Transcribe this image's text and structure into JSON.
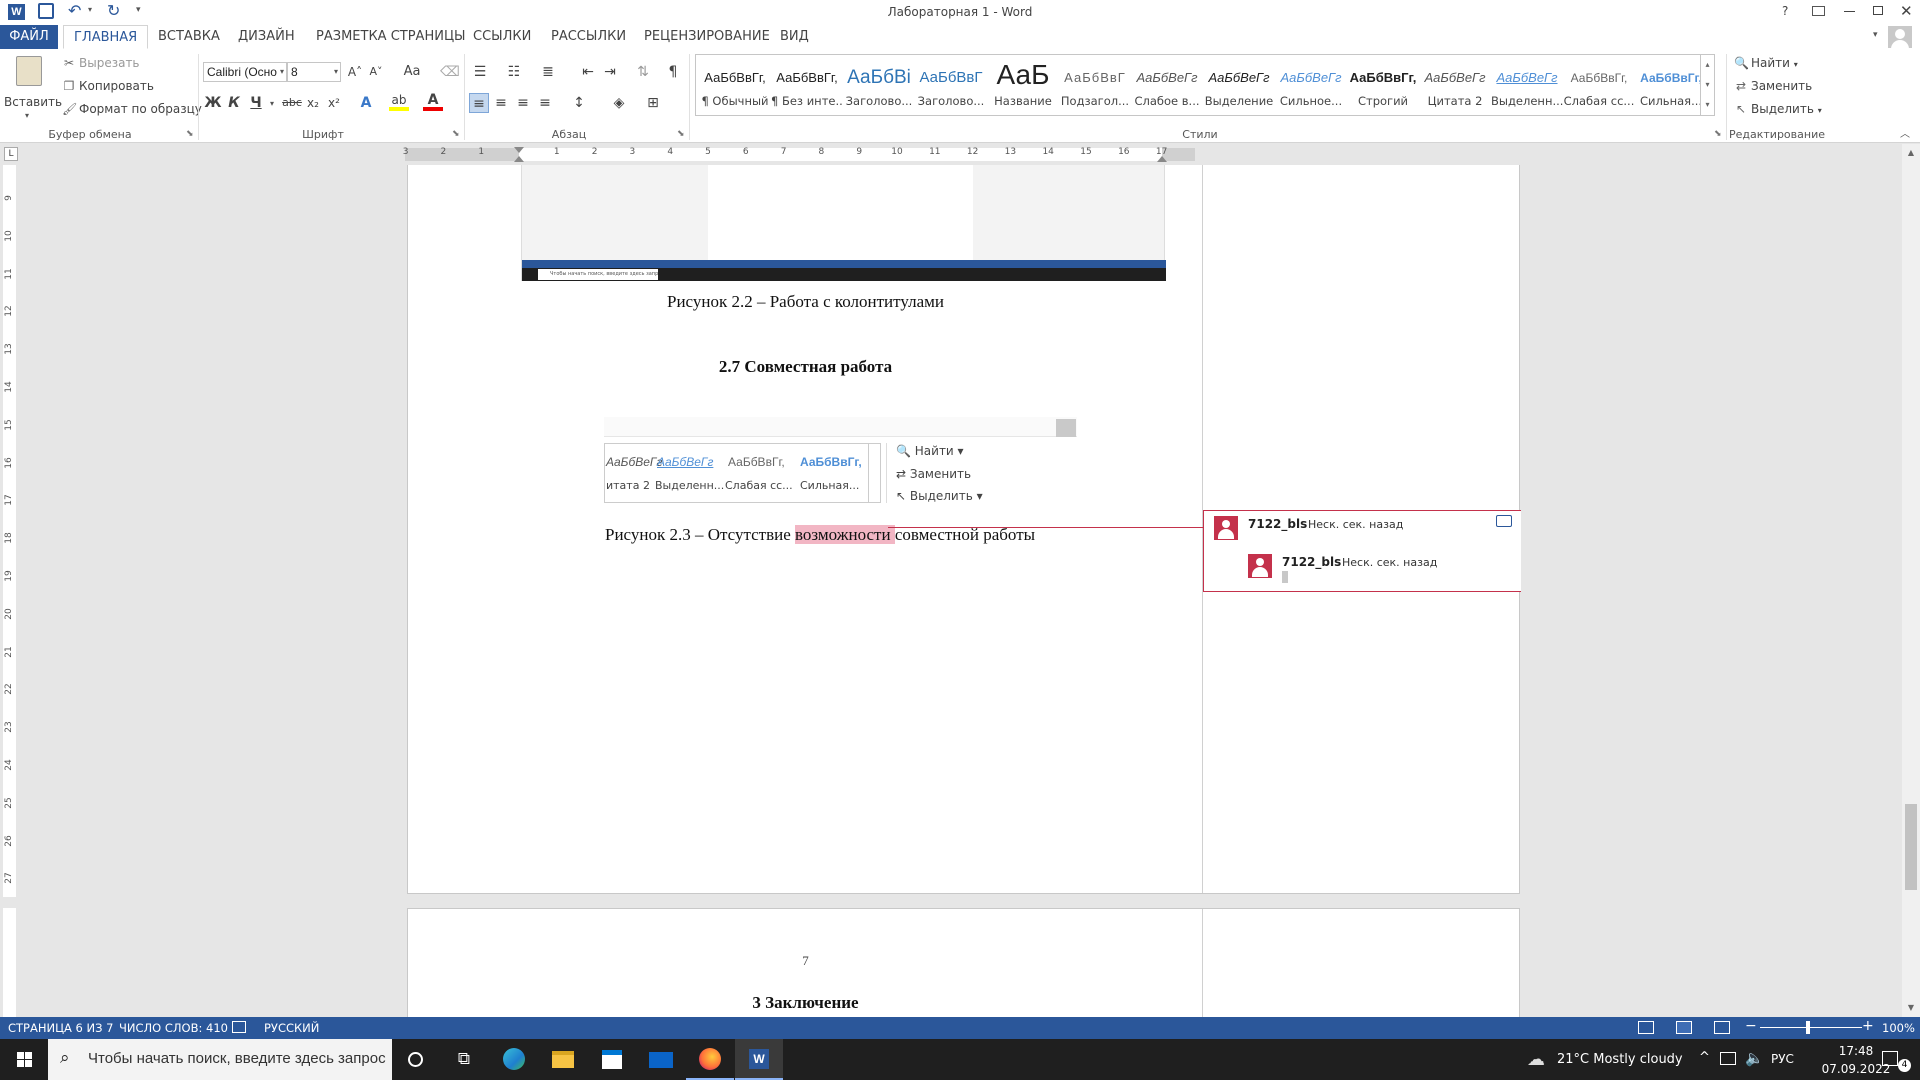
{
  "window": {
    "title": "Лабораторная 1 - Word",
    "controls": [
      "?",
      "⧉",
      "—",
      "❐",
      "✕"
    ]
  },
  "tabs": [
    {
      "label": "ФАЙЛ"
    },
    {
      "label": "ГЛАВНАЯ"
    },
    {
      "label": "ВСТАВКА"
    },
    {
      "label": "ДИЗАЙН"
    },
    {
      "label": "РАЗМЕТКА СТРАНИЦЫ"
    },
    {
      "label": "ССЫЛКИ"
    },
    {
      "label": "РАССЫЛКИ"
    },
    {
      "label": "РЕЦЕНЗИРОВАНИЕ"
    },
    {
      "label": "ВИД"
    }
  ],
  "clipboard": {
    "paste": "Вставить",
    "cut": "Вырезать",
    "copy": "Копировать",
    "format_painter": "Формат по образцу",
    "group": "Буфер обмена"
  },
  "font": {
    "name": "Calibri (Осно",
    "size": "8",
    "group": "Шрифт",
    "bold": "Ж",
    "italic": "К",
    "underline": "Ч",
    "strike": "abc",
    "sub": "x₂",
    "sup": "x²",
    "grow": "A˄",
    "shrink": "A˅",
    "case": "Aa"
  },
  "paragraph": {
    "group": "Абзац"
  },
  "styles": {
    "group": "Стили",
    "items": [
      {
        "sample": "АаБбВвГг,",
        "name": "¶ Обычный"
      },
      {
        "sample": "АаБбВвГг,",
        "name": "¶ Без инте..."
      },
      {
        "sample": "АаБбВі",
        "name": "Заголово..."
      },
      {
        "sample": "АаБбВвГ",
        "name": "Заголово..."
      },
      {
        "sample": "АаБ",
        "name": "Название"
      },
      {
        "sample": "АаБбВвГ",
        "name": "Подзагол..."
      },
      {
        "sample": "АаБбВеГг",
        "name": "Слабое в..."
      },
      {
        "sample": "АаБбВеГг",
        "name": "Выделение"
      },
      {
        "sample": "АаБбВеГг",
        "name": "Сильное..."
      },
      {
        "sample": "АаБбВвГг,",
        "name": "Строгий"
      },
      {
        "sample": "АаБбВеГг",
        "name": "Цитата 2"
      },
      {
        "sample": "АаБбВеГг",
        "name": "Выделенн..."
      },
      {
        "sample": "АаБбВвГг,",
        "name": "Слабая сс..."
      },
      {
        "sample": "АаБбВвГг,",
        "name": "Сильная..."
      }
    ]
  },
  "editing": {
    "find": "Найти",
    "replace": "Заменить",
    "select": "Выделить",
    "group": "Редактирование"
  },
  "ruler": {
    "h_ticks": [
      "3",
      "2",
      "1",
      "1",
      "2",
      "3",
      "4",
      "5",
      "6",
      "7",
      "8",
      "9",
      "10",
      "11",
      "12",
      "13",
      "14",
      "15",
      "16",
      "17"
    ],
    "v_ticks": [
      "9",
      "10",
      "11",
      "12",
      "13",
      "14",
      "15",
      "16",
      "17",
      "18",
      "19",
      "20",
      "21",
      "22",
      "23",
      "24",
      "25",
      "26",
      "27"
    ]
  },
  "document": {
    "caption_2_2": "Рисунок 2.2 – Работа с колонтитулами",
    "heading_2_7": "2.7 Совместная работа",
    "caption_2_3_before": "Рисунок 2.3 – Отсутствие ",
    "caption_2_3_highlight": "возможности ",
    "caption_2_3_after": "совместной работы",
    "page_number": "7",
    "heading_3": "3 Заключение",
    "embedded_taskbar_search": "Чтобы начать поиск, введите здесь запрос",
    "embedded_styles": [
      {
        "sample": "АаБбВеГг",
        "name": "итата 2"
      },
      {
        "sample": "АаБбВеГг",
        "name": "Выделенн..."
      },
      {
        "sample": "АаБбВвГг,",
        "name": "Слабая сс..."
      },
      {
        "sample": "АаБбВвГг,",
        "name": "Сильная..."
      }
    ],
    "embedded_find": "Найти",
    "embedded_replace": "Заменить",
    "embedded_select": "Выделить"
  },
  "comments": [
    {
      "author": "7122_bls",
      "time": "Неск. сек. назад"
    },
    {
      "author": "7122_bls",
      "time": "Неск. сек. назад"
    }
  ],
  "status": {
    "page": "СТРАНИЦА 6 ИЗ 7",
    "words": "ЧИСЛО СЛОВ: 410",
    "lang": "РУССКИЙ",
    "zoom": "100%"
  },
  "taskbar": {
    "search_placeholder": "Чтобы начать поиск, введите здесь запрос",
    "weather": "21°C  Mostly cloudy",
    "lang": "РУС",
    "time": "17:48",
    "date": "07.09.2022",
    "notif_count": "4"
  },
  "colors": {
    "accent": "#2b579a",
    "comment": "#c4314b",
    "highlight": "#f2b6c4"
  }
}
